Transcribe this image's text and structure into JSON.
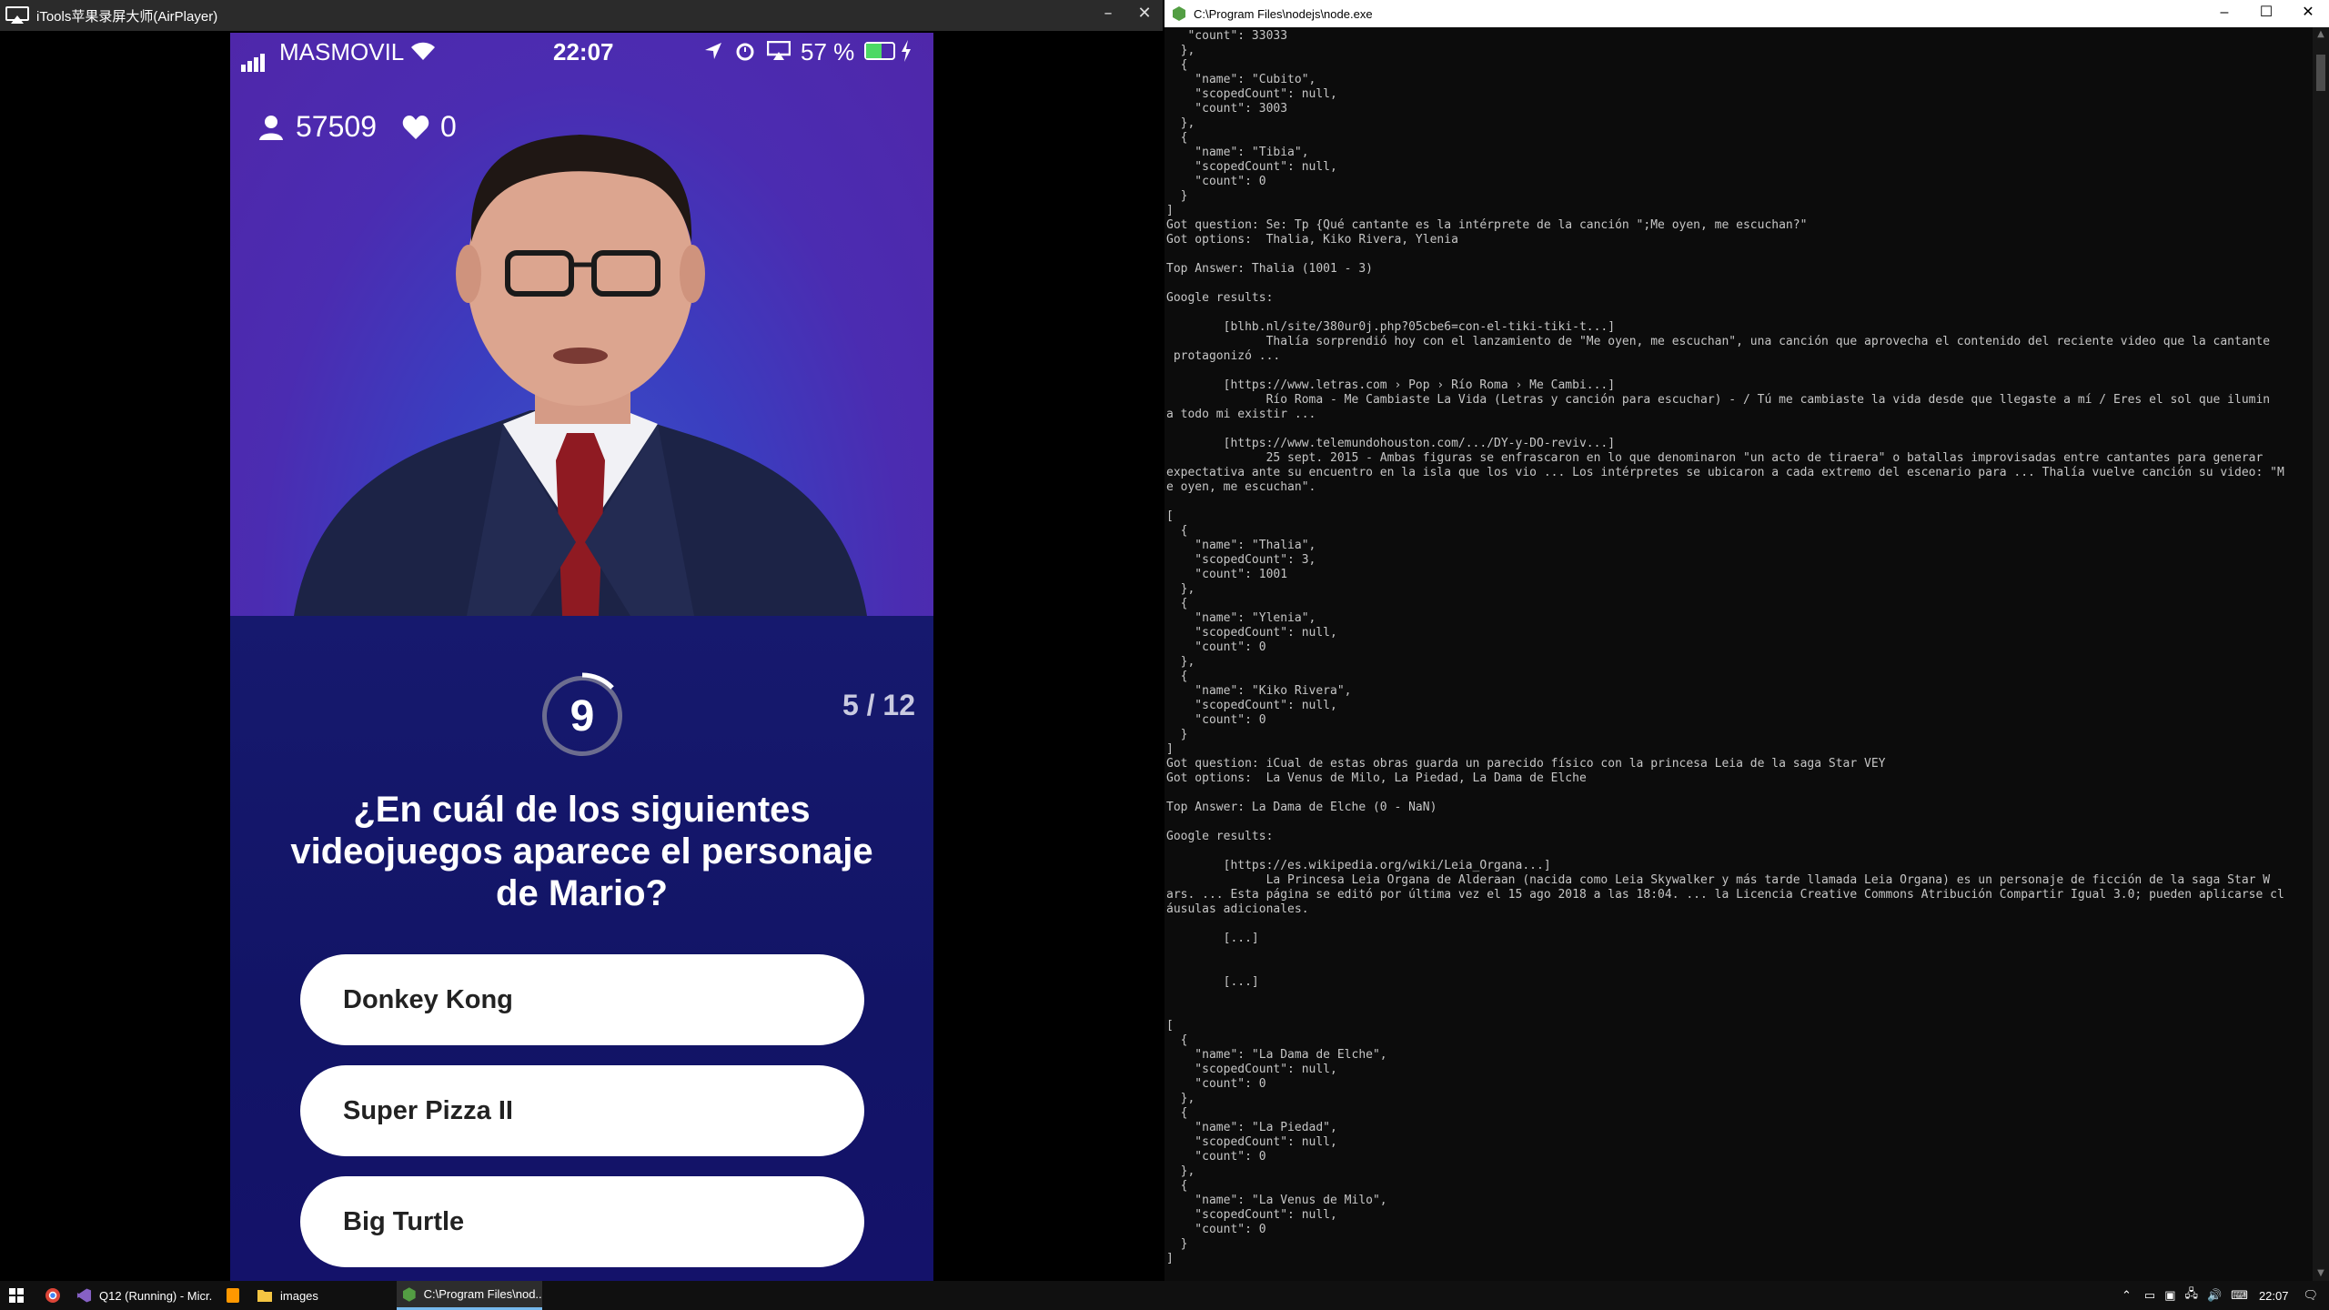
{
  "airplayer": {
    "title": "iTools苹果录屏大师(AirPlayer)"
  },
  "phone": {
    "status": {
      "carrier": "MASMOVIL",
      "time": "22:07",
      "battery": "57 %"
    },
    "stats": {
      "players": "57509",
      "lives": "0"
    },
    "timer": "9",
    "progress": "5 / 12",
    "question": "¿En cuál de los siguientes videojuegos aparece el personaje de Mario?",
    "answers": [
      "Donkey Kong",
      "Super Pizza II",
      "Big Turtle"
    ]
  },
  "console": {
    "title": "C:\\Program Files\\nodejs\\node.exe",
    "output": "   \"count\": 33033\n  },\n  {\n    \"name\": \"Cubito\",\n    \"scopedCount\": null,\n    \"count\": 3003\n  },\n  {\n    \"name\": \"Tibia\",\n    \"scopedCount\": null,\n    \"count\": 0\n  }\n]\nGot question: Se: Tp {Qué cantante es la intérprete de la canción \";Me oyen, me escuchan?\"\nGot options:  Thalia, Kiko Rivera, Ylenia\n\nTop Answer: Thalia (1001 - 3)\n\nGoogle results:\n\n        [blhb.nl/site/380ur0j.php?05cbe6=con-el-tiki-tiki-t...]\n              Thalía sorprendió hoy con el lanzamiento de \"Me oyen, me escuchan\", una canción que aprovecha el contenido del reciente video que la cantante\n protagonizó ...\n\n        [https://www.letras.com › Pop › Río Roma › Me Cambi...]\n              Río Roma - Me Cambiaste La Vida (Letras y canción para escuchar) - / Tú me cambiaste la vida desde que llegaste a mí / Eres el sol que ilumin\na todo mi existir ...\n\n        [https://www.telemundohouston.com/.../DY-y-DO-reviv...]\n              25 sept. 2015 - Ambas figuras se enfrascaron en lo que denominaron \"un acto de tiraera\" o batallas improvisadas entre cantantes para generar\nexpectativa ante su encuentro en la isla que los vio ... Los intérpretes se ubicaron a cada extremo del escenario para ... Thalía vuelve canción su video: \"M\ne oyen, me escuchan\".\n\n[\n  {\n    \"name\": \"Thalia\",\n    \"scopedCount\": 3,\n    \"count\": 1001\n  },\n  {\n    \"name\": \"Ylenia\",\n    \"scopedCount\": null,\n    \"count\": 0\n  },\n  {\n    \"name\": \"Kiko Rivera\",\n    \"scopedCount\": null,\n    \"count\": 0\n  }\n]\nGot question: iCual de estas obras guarda un parecido físico con la princesa Leia de la saga Star VEY\nGot options:  La Venus de Milo, La Piedad, La Dama de Elche\n\nTop Answer: La Dama de Elche (0 - NaN)\n\nGoogle results:\n\n        [https://es.wikipedia.org/wiki/Leia_Organa...]\n              La Princesa Leia Organa de Alderaan (nacida como Leia Skywalker y más tarde llamada Leia Organa) es un personaje de ficción de la saga Star W\nars. ... Esta página se editó por última vez el 15 ago 2018 a las 18:04. ... la Licencia Creative Commons Atribución Compartir Igual 3.0; pueden aplicarse cl\náusulas adicionales.\n\n        [...]\n\n\n        [...]\n\n\n[\n  {\n    \"name\": \"La Dama de Elche\",\n    \"scopedCount\": null,\n    \"count\": 0\n  },\n  {\n    \"name\": \"La Piedad\",\n    \"scopedCount\": null,\n    \"count\": 0\n  },\n  {\n    \"name\": \"La Venus de Milo\",\n    \"scopedCount\": null,\n    \"count\": 0\n  }\n]"
  },
  "taskbar": {
    "items": [
      "Q12 (Running) - Micr...",
      "images",
      "C:\\Program Files\\nod..."
    ],
    "clock": "22:07"
  },
  "colors": {
    "accent": "#76b9ed",
    "phone_purple": "#4a2fb3",
    "phone_navy": "#14156c"
  }
}
